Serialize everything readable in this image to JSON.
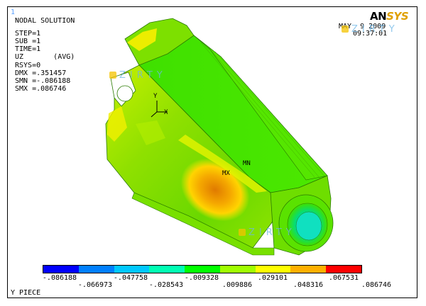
{
  "window_number": "1",
  "logo": {
    "ans": "AN",
    "sys": "SYS"
  },
  "timestamp": {
    "date": "MAY  9 2009",
    "time": "09:37:01"
  },
  "info": {
    "title": "NODAL SOLUTION",
    "lines": [
      "STEP=1",
      "SUB =1",
      "TIME=1",
      "UZ       (AVG)",
      "RSYS=0",
      "DMX =.351457",
      "SMN =-.086188",
      "SMX =.086746"
    ]
  },
  "triad": {
    "y_label": "Y",
    "x_label": "X"
  },
  "markers": {
    "mx": "MX",
    "mn": "MN"
  },
  "watermark_text": "ZIRTY",
  "legend": {
    "colors": [
      "#0000ff",
      "#0080ff",
      "#00c8ff",
      "#00ffb4",
      "#00ff00",
      "#a0ff00",
      "#ffff00",
      "#ffb000",
      "#ff0000"
    ],
    "top_labels": [
      "-.086188",
      "-.047758",
      "-.009328",
      ".029101",
      ".067531"
    ],
    "bottom_labels": [
      "-.066973",
      "-.028543",
      ".009886",
      ".048316",
      ".086746"
    ]
  },
  "caption": "Y PIECE"
}
